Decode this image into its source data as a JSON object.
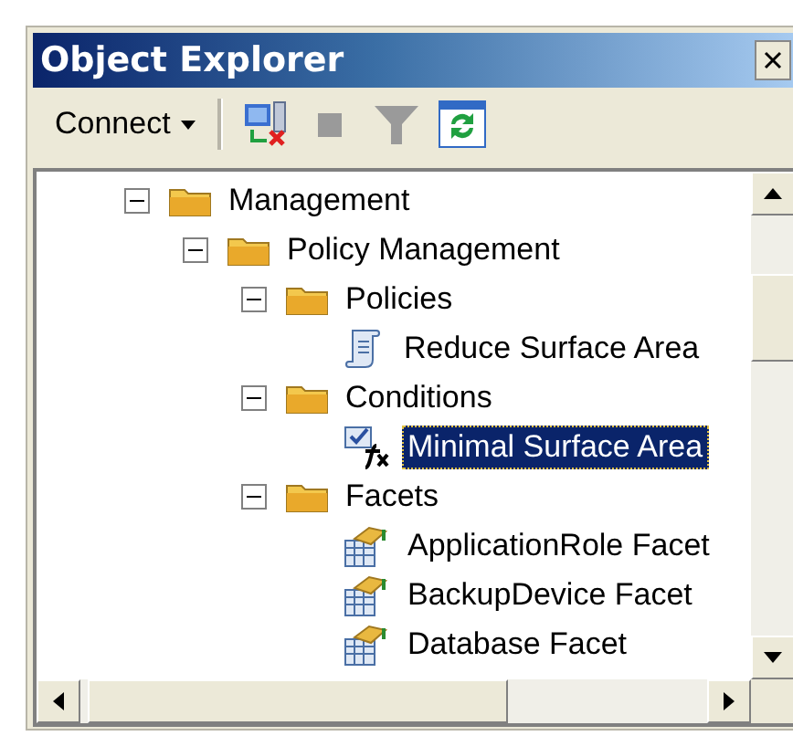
{
  "window": {
    "title": "Object Explorer"
  },
  "toolbar": {
    "connect": {
      "label": "Connect"
    },
    "buttons": [
      {
        "kind": "disconnect",
        "disabled": false
      },
      {
        "kind": "stop",
        "disabled": true
      },
      {
        "kind": "filter",
        "disabled": true
      },
      {
        "kind": "refresh",
        "disabled": false
      }
    ]
  },
  "tree": [
    {
      "label": "Management",
      "kind": "folder",
      "expanded": true,
      "selected": false,
      "children": [
        {
          "label": "Policy Management",
          "kind": "folder",
          "expanded": true,
          "selected": false,
          "children": [
            {
              "label": "Policies",
              "kind": "folder",
              "expanded": true,
              "selected": false,
              "children": [
                {
                  "label": "Reduce Surface Area",
                  "kind": "policy",
                  "selected": false
                }
              ]
            },
            {
              "label": "Conditions",
              "kind": "folder",
              "expanded": true,
              "selected": false,
              "children": [
                {
                  "label": "Minimal Surface Area",
                  "kind": "condition",
                  "selected": true
                }
              ]
            },
            {
              "label": "Facets",
              "kind": "folder",
              "expanded": true,
              "selected": false,
              "children": [
                {
                  "label": "ApplicationRole Facet",
                  "kind": "facet",
                  "selected": false
                },
                {
                  "label": "BackupDevice Facet",
                  "kind": "facet",
                  "selected": false
                },
                {
                  "label": "Database Facet",
                  "kind": "facet",
                  "selected": false
                }
              ]
            }
          ]
        }
      ]
    }
  ]
}
